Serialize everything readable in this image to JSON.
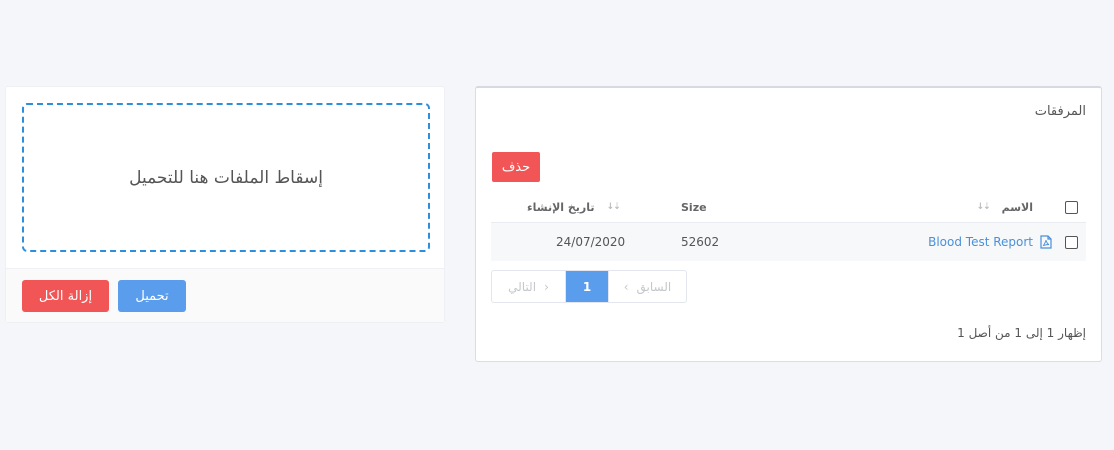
{
  "upload": {
    "dropzone_text": "إسقاط الملفات هنا للتحميل",
    "upload_label": "تحميل",
    "remove_all_label": "إزالة الكل"
  },
  "attachments": {
    "title": "المرفقات",
    "delete_label": "حذف",
    "columns": {
      "name": "الاسم",
      "size": "Size",
      "created": "تاريخ الإنشاء"
    },
    "rows": [
      {
        "name": "Blood Test Report",
        "size": "52602",
        "created": "24/07/2020",
        "icon": "pdf-file-icon"
      }
    ],
    "pagination": {
      "prev_label": "السابق",
      "current_page": "1",
      "next_label": "التالي"
    },
    "summary": "إظهار 1 إلى 1 من أصل 1"
  },
  "colors": {
    "primary": "#5b9ded",
    "danger": "#f25555",
    "dropzone_border": "#2b8fde",
    "link": "#4a90d9"
  }
}
